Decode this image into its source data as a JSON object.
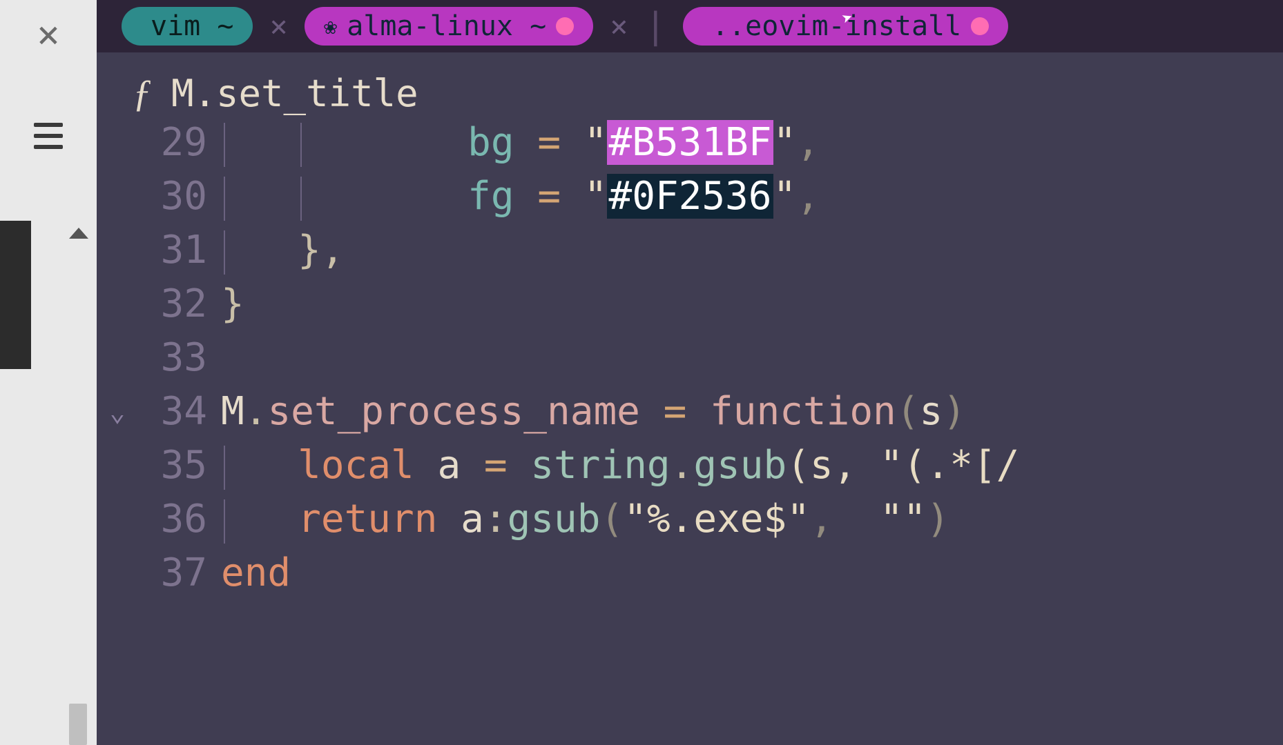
{
  "tabs": [
    {
      "label": "vim ~",
      "icon": "",
      "kind": "vim",
      "active": false,
      "modified": false
    },
    {
      "label": "alma-linux ~",
      "icon": "❀",
      "kind": "alma",
      "active": true,
      "modified": true
    },
    {
      "label": "..eovim-install",
      "icon": "",
      "kind": "neovim",
      "active": false,
      "modified": true
    }
  ],
  "tab_close_glyph": "×",
  "tab_sep_glyph": "|",
  "breadcrumb": {
    "prefix": "ƒ",
    "path": "M.set_title"
  },
  "code": {
    "lines": [
      {
        "n": 29,
        "indent": 2,
        "key": "bg",
        "value": "#B531BF",
        "hilite": "bg"
      },
      {
        "n": 30,
        "indent": 2,
        "key": "fg",
        "value": "#0F2536",
        "hilite": "fg"
      },
      {
        "n": 31,
        "indent": 1,
        "raw_close": "},"
      },
      {
        "n": 32,
        "indent": 0,
        "raw_close": "}"
      },
      {
        "n": 33,
        "indent": 0,
        "blank": true
      },
      {
        "n": 34,
        "fn_def": {
          "lhs_obj": "M",
          "lhs_method": "set_process_name",
          "param": "s"
        },
        "foldable": true
      },
      {
        "n": 35,
        "local_assign": {
          "var": "a",
          "call_obj": "string",
          "call_fn": "gsub",
          "args_raw": "(s, \"(.*[/"
        }
      },
      {
        "n": 36,
        "return_stmt": {
          "obj": "a",
          "fn": "gsub",
          "str1": "\"%.exe$\"",
          "str2": "\"\""
        }
      },
      {
        "n": 37,
        "end_kw": "end"
      }
    ]
  },
  "colors": {
    "tab_teal": "#2d8b8b",
    "tab_magenta": "#b837c0",
    "editor_bg": "#403d52",
    "tab_bar_bg": "#2d2438",
    "hex_bg_hilite": "#c85ad4",
    "hex_fg_hilite": "#0f2536"
  }
}
